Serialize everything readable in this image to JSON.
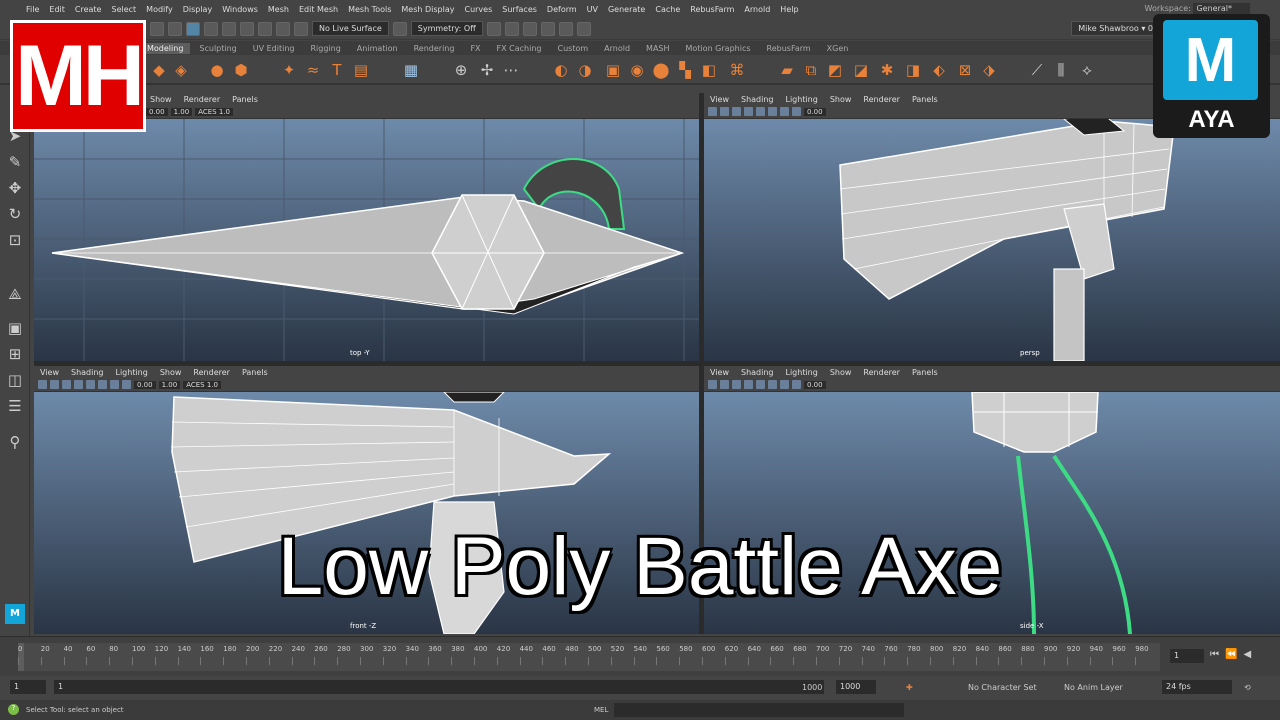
{
  "menu": [
    "File",
    "Edit",
    "Create",
    "Select",
    "Modify",
    "Display",
    "Windows",
    "Mesh",
    "Edit Mesh",
    "Mesh Tools",
    "Mesh Display",
    "Curves",
    "Surfaces",
    "Deform",
    "UV",
    "Generate",
    "Cache",
    "RebusFarm",
    "Arnold",
    "Help"
  ],
  "workspace": {
    "label": "Workspace:",
    "value": "General*"
  },
  "status": {
    "live_surface": "No Live Surface",
    "symmetry": "Symmetry: Off",
    "user": "Mike Shawbroo",
    "count": "0"
  },
  "shelf_tabs": [
    "Modeling",
    "Sculpting",
    "UV Editing",
    "Rigging",
    "Animation",
    "Rendering",
    "FX",
    "FX Caching",
    "Custom",
    "Arnold",
    "MASH",
    "Motion Graphics",
    "RebusFarm",
    "XGen"
  ],
  "panel_menu": [
    "View",
    "Shading",
    "Lighting",
    "Show",
    "Renderer",
    "Panels"
  ],
  "panel_menu_tl": [
    "Show",
    "Renderer",
    "Panels"
  ],
  "panel_tool": {
    "value1": "0.00",
    "value2": "1.00",
    "colorspace": "ACES 1.0"
  },
  "viewports": {
    "tl": "top -Y",
    "tr": "persp",
    "bl": "front -Z",
    "br": "side -X"
  },
  "timeline": {
    "ticks": [
      "0",
      "20",
      "40",
      "60",
      "80",
      "100",
      "120",
      "140",
      "160",
      "180",
      "200",
      "220",
      "240",
      "260",
      "280",
      "300",
      "320",
      "340",
      "360",
      "380",
      "400",
      "420",
      "440",
      "460",
      "480",
      "500",
      "520",
      "540",
      "560",
      "580",
      "600",
      "620",
      "640",
      "660",
      "680",
      "700",
      "720",
      "740",
      "760",
      "780",
      "800",
      "820",
      "840",
      "860",
      "880",
      "900",
      "920",
      "940",
      "960",
      "980"
    ],
    "current": "1",
    "current_frame": "1"
  },
  "range": {
    "start": "1",
    "inner_start": "1",
    "inner_end": "1000",
    "end": "1000",
    "character_set": "No Character Set",
    "anim_layer": "No Anim Layer",
    "fps": "24 fps"
  },
  "command": {
    "lang": "MEL",
    "help": "Select Tool: select an object"
  },
  "overlay": {
    "title": "Low Poly Battle Axe",
    "channel_logo": "MH",
    "app_logo_letter": "M",
    "app_logo_text": "AYA"
  },
  "colors": {
    "accent_red": "#e00000",
    "maya_blue": "#13a5d8",
    "selection_green": "#3ddc84"
  }
}
